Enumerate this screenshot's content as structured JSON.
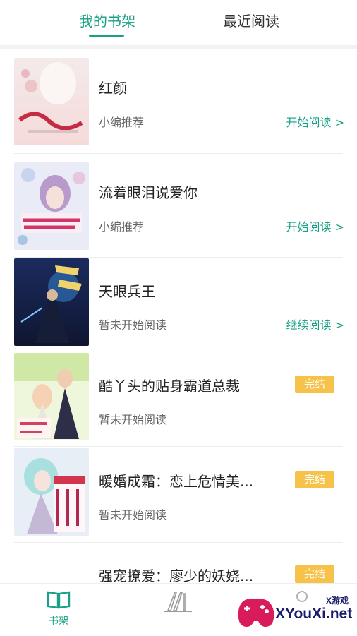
{
  "header": {
    "tabs": [
      {
        "label": "我的书架",
        "active": true
      },
      {
        "label": "最近阅读",
        "active": false
      }
    ]
  },
  "books": [
    {
      "title": "红颜",
      "status": "小编推荐",
      "action": "开始阅读 >",
      "badge": ""
    },
    {
      "title": "流着眼泪说爱你",
      "status": "小编推荐",
      "action": "开始阅读 >",
      "badge": ""
    },
    {
      "title": "天眼兵王",
      "status": "暂未开始阅读",
      "action": "继续阅读 >",
      "badge": ""
    },
    {
      "title": "酷丫头的贴身霸道总裁",
      "status": "暂未开始阅读",
      "action": "",
      "badge": "完结"
    },
    {
      "title": "暖婚成霜：恋上危情美...",
      "status": "暂未开始阅读",
      "action": "",
      "badge": "完结"
    },
    {
      "title": "强宠撩爱：廖少的妖娆...",
      "status": "",
      "action": "",
      "badge": "完结"
    }
  ],
  "bottom_nav": {
    "shelf_label": "书架"
  },
  "watermark": {
    "brand": "XYouXi.net",
    "small": "X游戏"
  },
  "colors": {
    "accent": "#1aa086",
    "badge": "#f7c24a"
  }
}
